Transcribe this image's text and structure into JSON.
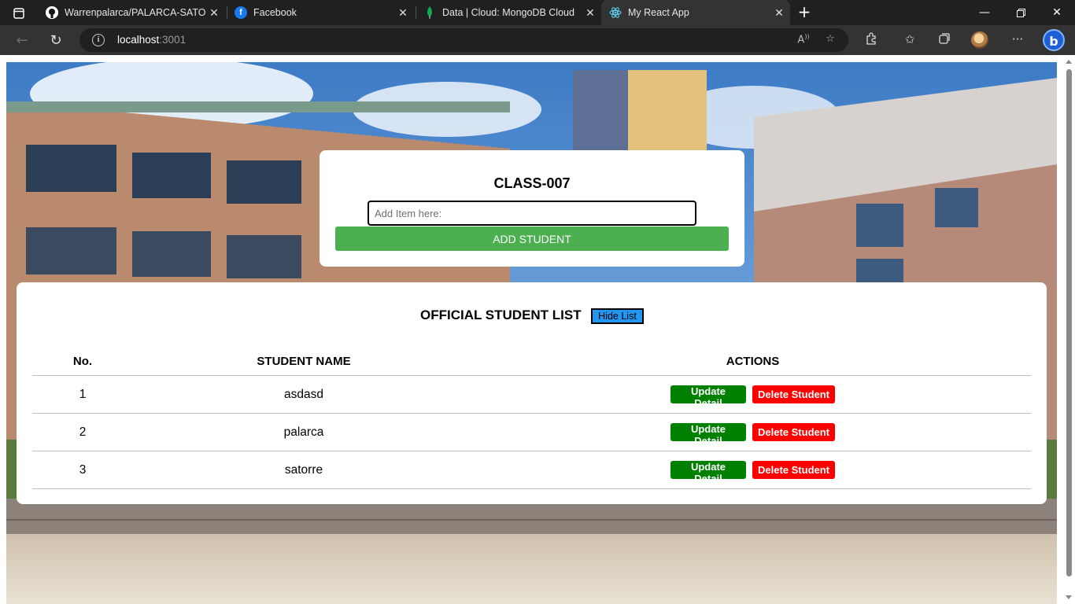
{
  "browser": {
    "tabs": [
      {
        "title": "Warrenpalarca/PALARCA-SATORRE",
        "favicon": "github-icon",
        "active": false
      },
      {
        "title": "Facebook",
        "favicon": "facebook-icon",
        "active": false
      },
      {
        "title": "Data | Cloud: MongoDB Cloud",
        "favicon": "mongodb-leaf-icon",
        "active": false
      },
      {
        "title": "My React App",
        "favicon": "react-icon",
        "active": true
      }
    ],
    "url_host": "localhost",
    "url_port": ":3001",
    "accent": "#1f5fd6"
  },
  "app": {
    "class_title": "CLASS-007",
    "input_placeholder": "Add Item here:",
    "input_value": "",
    "add_button_label": "ADD STUDENT",
    "list_title": "OFFICIAL STUDENT LIST",
    "hide_button_label": "Hide List",
    "headers": {
      "no": "No.",
      "name": "STUDENT NAME",
      "actions": "ACTIONS"
    },
    "rows": [
      {
        "no": "1",
        "name": "asdasd",
        "update_label": "Update Detail",
        "delete_label": "Delete Student"
      },
      {
        "no": "2",
        "name": "palarca",
        "update_label": "Update Detail",
        "delete_label": "Delete Student"
      },
      {
        "no": "3",
        "name": "satorre",
        "update_label": "Update Detail",
        "delete_label": "Delete Student"
      }
    ],
    "colors": {
      "add": "#4caf50",
      "update": "#008000",
      "delete": "#ff0000",
      "hide": "#2196f3"
    }
  }
}
